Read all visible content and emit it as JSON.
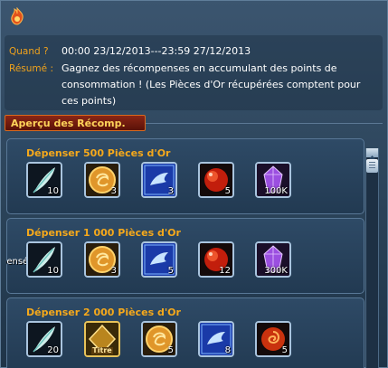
{
  "info": {
    "quand_label": "Quand ?",
    "quand_value": "00:00 23/12/2013---23:59 27/12/2013",
    "resume_label": "Résumé",
    "resume_line1": "Gagnez des récompenses en accumulant des points de",
    "resume_line2": "consommation ! (Les Pièces d'Or récupérées comptent pour",
    "resume_line3": "ces points)"
  },
  "section": {
    "title": "Aperçu des Récomp."
  },
  "tiers": [
    {
      "title": "Dépenser 500 Pièces d'Or",
      "rewards": [
        {
          "icon": "feather-icon",
          "qty": "10"
        },
        {
          "icon": "gold-coin-icon",
          "qty": "3"
        },
        {
          "icon": "blue-wing-scroll-icon",
          "qty": "3"
        },
        {
          "icon": "red-orb-icon",
          "qty": "5"
        },
        {
          "icon": "purple-crystal-icon",
          "qty": "100K"
        }
      ]
    },
    {
      "title": "Dépenser 1 000 Pièces d'Or",
      "overflow_text": "pensé",
      "rewards": [
        {
          "icon": "feather-icon",
          "qty": "10"
        },
        {
          "icon": "gold-coin-icon",
          "qty": "3"
        },
        {
          "icon": "blue-wing-scroll-icon",
          "qty": "5"
        },
        {
          "icon": "red-orb-icon",
          "qty": "12"
        },
        {
          "icon": "purple-crystal-icon",
          "qty": "300K"
        }
      ]
    },
    {
      "title": "Dépenser 2 000 Pièces d'Or",
      "rewards": [
        {
          "icon": "feather-icon",
          "qty": "20"
        },
        {
          "icon": "title-badge-icon",
          "qty": "",
          "badge_text": "Titre"
        },
        {
          "icon": "gold-coin-icon",
          "qty": "5"
        },
        {
          "icon": "blue-wing-scroll-icon",
          "qty": "8"
        },
        {
          "icon": "red-swirl-orb-icon",
          "qty": "5"
        }
      ]
    }
  ]
}
